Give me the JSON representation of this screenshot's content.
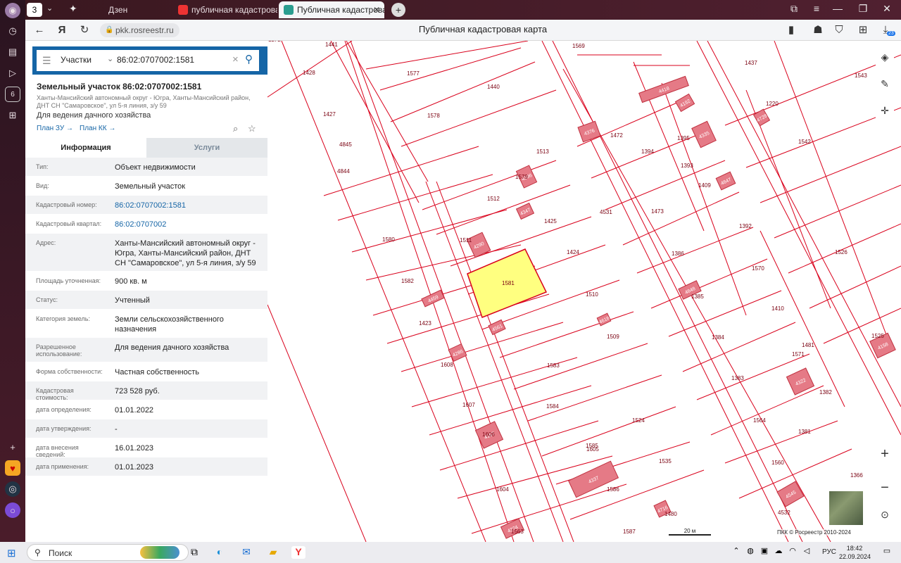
{
  "browser": {
    "dock_icons": [
      "avatar-icon",
      "clock-icon",
      "collections-icon",
      "video-icon",
      "number-icon",
      "games-icon"
    ],
    "dock_six": "6",
    "tab_count": "3",
    "tabs": [
      {
        "label": "Дзен"
      },
      {
        "label": "публичная кадастровая к"
      },
      {
        "label": "Публичная кадастровая ка"
      }
    ],
    "url": "pkk.rosreestr.ru",
    "page_title": "Публичная кадастровая карта",
    "downloads_badge": "23"
  },
  "search": {
    "mode": "Участки",
    "query": "86:02:0707002:1581"
  },
  "object": {
    "title": "Земельный участок 86:02:0707002:1581",
    "address": "Ханты-Мансийский автономный округ - Югра, Ханты-Мансийский район, ДНТ СН \"Самаровское\", ул 5-я линия, з/у 59",
    "purpose": "Для ведения дачного хозяйства",
    "plan_zu": "План ЗУ →",
    "plan_kk": "План КК →"
  },
  "tabs": {
    "info": "Информация",
    "services": "Услуги"
  },
  "rows": [
    {
      "k": "Тип:",
      "v": "Объект недвижимости"
    },
    {
      "k": "Вид:",
      "v": "Земельный участок"
    },
    {
      "k": "Кадастровый номер:",
      "v": "86:02:0707002:1581",
      "link": true
    },
    {
      "k": "Кадастровый квартал:",
      "v": "86:02:0707002",
      "link": true
    },
    {
      "k": "Адрес:",
      "v": "Ханты-Мансийский автономный округ - Югра, Ханты-Мансийский район, ДНТ СН \"Самаровское\", ул 5-я линия, з/у 59"
    },
    {
      "k": "Площадь уточненная:",
      "v": "900 кв. м"
    },
    {
      "k": "Статус:",
      "v": "Учтенный"
    },
    {
      "k": "Категория земель:",
      "v": "Земли сельскохозяйственного назначения"
    },
    {
      "k": "Разрешенное использование:",
      "v": "Для ведения дачного хозяйства"
    },
    {
      "k": "Форма собственности:",
      "v": "Частная собственность"
    },
    {
      "k": "Кадастровая стоимость:",
      "v": "723 528 руб."
    },
    {
      "k": "дата определения:",
      "v": "01.01.2022"
    },
    {
      "k": "дата утверждения:",
      "v": "-"
    },
    {
      "k": "дата внесения сведений:",
      "v": "16.01.2023"
    },
    {
      "k": "дата применения:",
      "v": "01.01.2023"
    }
  ],
  "map": {
    "highlight_color": "#ffff80",
    "parcel_color": "#d9001b",
    "building_color": "#e57a86",
    "selected_label": "1581",
    "parcel_labels": [
      "1441",
      "1569",
      "1428",
      "1577",
      "1440",
      "1427",
      "1578",
      "4845",
      "4844",
      "1513",
      "1579",
      "1512",
      "1425",
      "1580",
      "1511",
      "1424",
      "1582",
      "1510",
      "1423",
      "1509",
      "1608",
      "1583",
      "1607",
      "1584",
      "1606",
      "1585",
      "1605",
      "1586",
      "1604",
      "1587",
      "1563",
      "1272",
      "1472",
      "1394",
      "1395",
      "1393",
      "1409",
      "1392",
      "1473",
      "1386",
      "1570",
      "1385",
      "1410",
      "1384",
      "1481",
      "1383",
      "1571",
      "1382",
      "1564",
      "1381",
      "1560",
      "1366",
      "1437",
      "1220",
      "1542",
      "1543",
      "1526",
      "1525",
      "1524",
      "1535",
      "1480",
      "4531",
      "4532"
    ],
    "building_labels": [
      "4418",
      "4192",
      "4396",
      "4728",
      "4376",
      "4335",
      "4847",
      "4347",
      "4290",
      "4848",
      "4459",
      "4618",
      "4561",
      "4286",
      "4322",
      "4167",
      "4337",
      "4716",
      "4374",
      "4158",
      "4545"
    ],
    "scale": "20 м",
    "copyright": "ПКК © Росреестр 2010-2024"
  },
  "taskbar": {
    "search_label": "Поиск",
    "lang": "РУС",
    "time": "18:42",
    "date": "22.09.2024"
  }
}
